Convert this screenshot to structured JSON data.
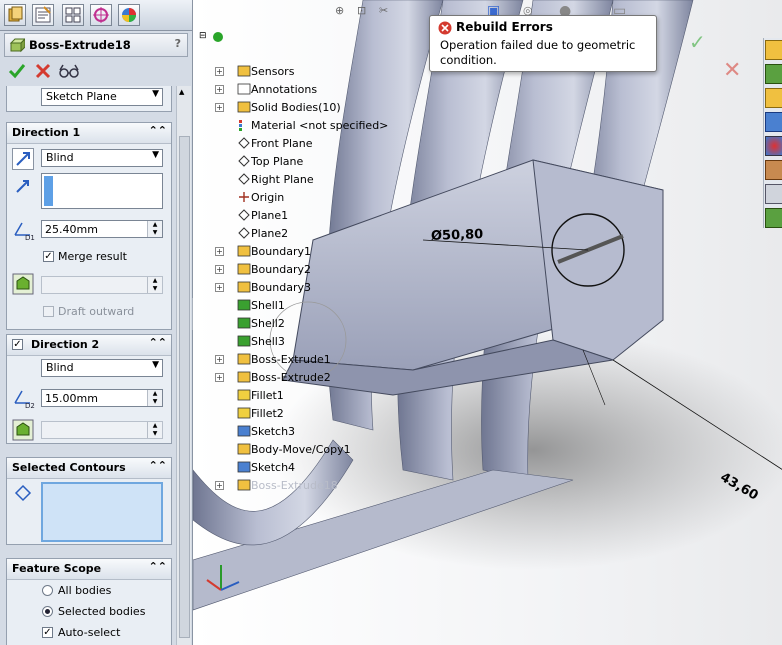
{
  "property_manager": {
    "title": "Boss-Extrude18",
    "help": "?",
    "from_value": "Sketch Plane",
    "direction1": {
      "header": "Direction 1",
      "end_condition": "Blind",
      "depth": "25.40mm",
      "depth_icon_label": "D1",
      "merge_result_label": "Merge result",
      "draft_outward_label": "Draft outward"
    },
    "direction2": {
      "header": "Direction 2",
      "end_condition": "Blind",
      "depth": "15.00mm",
      "depth_icon_label": "D2"
    },
    "selected_contours": {
      "header": "Selected Contours"
    },
    "feature_scope": {
      "header": "Feature Scope",
      "all_bodies": "All bodies",
      "selected_bodies": "Selected bodies",
      "auto_select": "Auto-select"
    }
  },
  "tooltip": {
    "title": "Rebuild Errors",
    "message": "Operation failed due to geometric condition."
  },
  "feature_tree": [
    {
      "label": "Sensors",
      "icon": "sensor-icon"
    },
    {
      "label": "Annotations",
      "icon": "annotation-icon"
    },
    {
      "label": "Solid Bodies(10)",
      "icon": "solid-bodies-icon"
    },
    {
      "label": "Material <not specified>",
      "icon": "material-icon"
    },
    {
      "label": "Front Plane",
      "icon": "plane-icon"
    },
    {
      "label": "Top Plane",
      "icon": "plane-icon"
    },
    {
      "label": "Right Plane",
      "icon": "plane-icon"
    },
    {
      "label": "Origin",
      "icon": "origin-icon"
    },
    {
      "label": "Plane1",
      "icon": "plane-icon"
    },
    {
      "label": "Plane2",
      "icon": "plane-icon"
    },
    {
      "label": "Boundary1",
      "icon": "boundary-icon"
    },
    {
      "label": "Boundary2",
      "icon": "boundary-icon"
    },
    {
      "label": "Boundary3",
      "icon": "boundary-icon"
    },
    {
      "label": "Shell1",
      "icon": "shell-icon"
    },
    {
      "label": "Shell2",
      "icon": "shell-icon"
    },
    {
      "label": "Shell3",
      "icon": "shell-icon"
    },
    {
      "label": "Boss-Extrude1",
      "icon": "extrude-icon"
    },
    {
      "label": "Boss-Extrude2",
      "icon": "extrude-icon"
    },
    {
      "label": "Fillet1",
      "icon": "fillet-icon"
    },
    {
      "label": "Fillet2",
      "icon": "fillet-icon"
    },
    {
      "label": "Sketch3",
      "icon": "sketch-icon"
    },
    {
      "label": "Body-Move/Copy1",
      "icon": "move-icon"
    },
    {
      "label": "Sketch4",
      "icon": "sketch-icon"
    },
    {
      "label": "Boss-Extrude18",
      "icon": "extrude-icon"
    }
  ],
  "dimensions": {
    "diameter": "Ø50,80",
    "length": "43,60"
  },
  "colors": {
    "panel_bg": "#d4dbe5",
    "part_color": "#a9afc6",
    "error_red": "#d43a2f",
    "accept_green": "#2aa52a"
  }
}
